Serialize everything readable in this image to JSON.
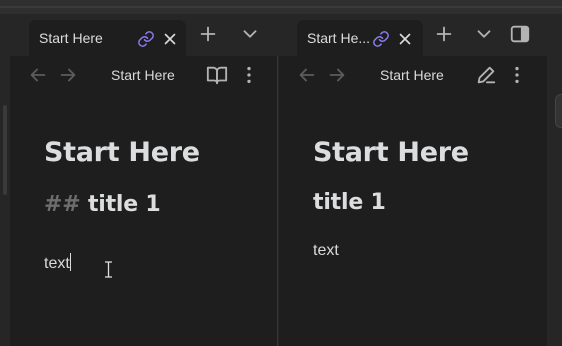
{
  "left_pane": {
    "tab": {
      "title": "Start Here",
      "link_icon": "link-icon",
      "close_icon": "close-icon"
    },
    "new_tab_icon": "plus-icon",
    "tab_list_icon": "chevron-down-icon",
    "header": {
      "back_icon": "arrow-left-icon",
      "forward_icon": "arrow-right-icon",
      "title": "Start Here",
      "mode_icon": "book-open-icon",
      "more_icon": "more-vertical-icon"
    },
    "content": {
      "h1": "Start Here",
      "h2_marker": "##",
      "h2": "title 1",
      "paragraph": "text"
    }
  },
  "right_pane": {
    "tab": {
      "title": "Start He...",
      "link_icon": "link-icon",
      "close_icon": "close-icon"
    },
    "new_tab_icon": "plus-icon",
    "tab_list_icon": "chevron-down-icon",
    "sidebar_toggle_icon": "sidebar-toggle-icon",
    "header": {
      "back_icon": "arrow-left-icon",
      "forward_icon": "arrow-right-icon",
      "title": "Start Here",
      "mode_icon": "pencil-icon",
      "more_icon": "more-vertical-icon"
    },
    "content": {
      "h1": "Start Here",
      "h2": "title 1",
      "paragraph": "text"
    }
  },
  "colors": {
    "background": "#262626",
    "pane": "#1e1e1e",
    "link_accent": "#8b7cf0",
    "text": "#dadada",
    "muted": "#6d6d6d"
  }
}
